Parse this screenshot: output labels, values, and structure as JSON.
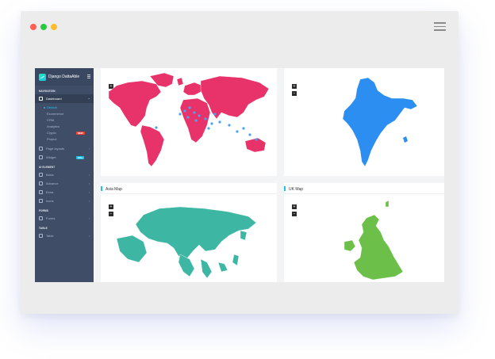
{
  "window": {
    "traffic_lights": [
      "#ff5f57",
      "#28c840",
      "#febc2e"
    ]
  },
  "brand": {
    "name": "Django DattaAble"
  },
  "sidebar": {
    "navigation_caption": "NAVIGATION",
    "dashboard": {
      "label": "Dashboard",
      "chevron": "›"
    },
    "submenu": [
      {
        "label": "Default"
      },
      {
        "label": "Ecommerce"
      },
      {
        "label": "CRM"
      },
      {
        "label": "Analytics"
      },
      {
        "label": "Crypto",
        "badge": "NEW"
      },
      {
        "label": "Project"
      }
    ],
    "page_layouts": {
      "label": "Page layouts",
      "chevron": "›"
    },
    "widget": {
      "label": "Widget",
      "badge": "100+"
    },
    "ui_caption": "UI ELEMENT",
    "ui_items": [
      {
        "label": "Basic",
        "chevron": "›"
      },
      {
        "label": "Advance",
        "chevron": "›"
      },
      {
        "label": "Extra",
        "chevron": "›"
      },
      {
        "label": "Icons",
        "chevron": "›"
      }
    ],
    "forms_caption": "FORMS",
    "forms": {
      "label": "Forms",
      "chevron": "›"
    },
    "table_caption": "TABLE",
    "table": {
      "label": "Table",
      "chevron": "›"
    }
  },
  "cards": {
    "world": {
      "zoom_in": "+",
      "zoom_out": "−",
      "color": "#e8336a",
      "marker_color": "#4aa3f2"
    },
    "india": {
      "zoom_in": "+",
      "zoom_out": "−",
      "color": "#2b8ef0"
    },
    "asia": {
      "title": "Asia Map",
      "zoom_in": "+",
      "zoom_out": "−",
      "color": "#3db7a4"
    },
    "uk": {
      "title": "UK Map",
      "zoom_in": "+",
      "zoom_out": "−",
      "color": "#6cc04a"
    }
  },
  "colors": {
    "accent": "#1dc4e9",
    "sidebar_bg": "#3f4d67",
    "badge_red": "#f44236",
    "badge_blue": "#1dc4e9"
  }
}
